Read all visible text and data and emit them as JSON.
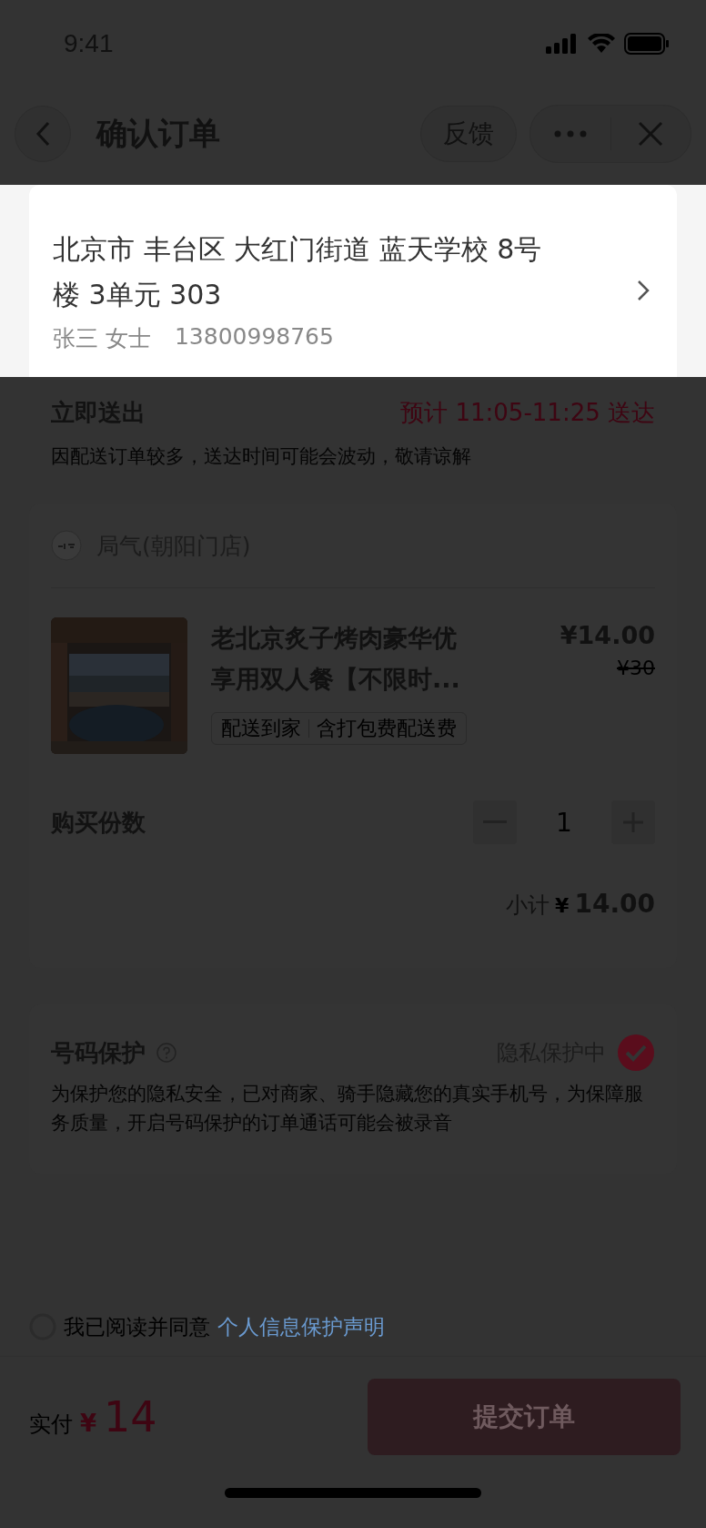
{
  "status_bar": {
    "time": "9:41"
  },
  "nav": {
    "title": "确认订单",
    "feedback": "反馈"
  },
  "address": {
    "line": "北京市 丰台区 大红门街道 蓝天学校 8号楼 3单元 303",
    "name": "张三 女士",
    "phone": "13800998765"
  },
  "delivery": {
    "mode": "立即送出",
    "eta": "预计 11:05-11:25 送达",
    "note": "因配送订单较多，送达时间可能会波动，敬请谅解"
  },
  "shop": {
    "name": "局气(朝阳门店)"
  },
  "product": {
    "kind": "picture",
    "title": "老北京炙子烤肉豪华优享用双人餐【不限时...",
    "price": "¥14.00",
    "original_price": "¥30",
    "tags": [
      "配送到家",
      "含打包费配送费"
    ]
  },
  "quantity": {
    "label": "购买份数",
    "value": "1"
  },
  "subtotal": {
    "label": "小计",
    "currency": "¥",
    "amount": "14.00"
  },
  "privacy": {
    "title": "号码保护",
    "status": "隐私保护中",
    "checked": true,
    "note": "为保护您的隐私安全，已对商家、骑手隐藏您的真实手机号，为保障服务质量，开启号码保护的订单通话可能会被录音"
  },
  "agreement": {
    "text": "我已阅读并同意",
    "link": "个人信息保护声明",
    "checked": false
  },
  "footer": {
    "label": "实付",
    "currency": "¥",
    "amount": "14",
    "submit": "提交订单"
  }
}
